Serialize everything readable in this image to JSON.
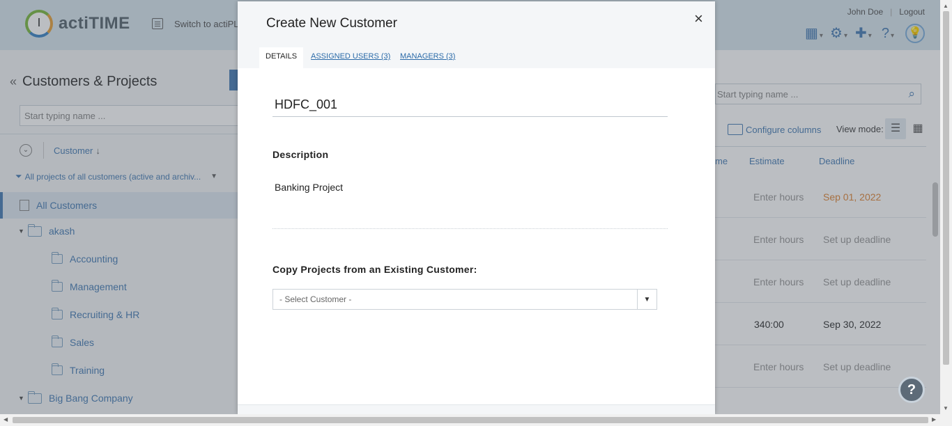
{
  "header": {
    "logo_text": "actiTIME",
    "switch_label": "Switch to actiPL",
    "user_name": "John Doe",
    "logout_label": "Logout"
  },
  "left_panel": {
    "title": "Customers & Projects",
    "search_placeholder": "Start typing name ...",
    "sort_label": "Customer",
    "filter_label": "All projects of all customers (active and archiv...",
    "all_customers_label": "All Customers",
    "tree": [
      {
        "label": "akash",
        "level": 0
      },
      {
        "label": "Accounting",
        "level": 1
      },
      {
        "label": "Management",
        "level": 1
      },
      {
        "label": "Recruiting & HR",
        "level": 1
      },
      {
        "label": "Sales",
        "level": 1
      },
      {
        "label": "Training",
        "level": 1
      },
      {
        "label": "Big Bang Company",
        "level": 0
      }
    ]
  },
  "right_panel": {
    "search_placeholder": "Start typing name ...",
    "configure_columns_label": "Configure columns",
    "view_mode_label": "View mode:",
    "columns": {
      "partial": "me",
      "estimate": "Estimate",
      "deadline": "Deadline"
    },
    "rows": [
      {
        "estimate": "Enter hours",
        "deadline": "Sep 01, 2022"
      },
      {
        "estimate": "Enter hours",
        "deadline": "Set up deadline"
      },
      {
        "estimate": "Enter hours",
        "deadline": "Set up deadline"
      },
      {
        "estimate": "340:00",
        "deadline": "Sep 30, 2022"
      },
      {
        "estimate": "Enter hours",
        "deadline": "Set up deadline"
      }
    ]
  },
  "modal": {
    "title": "Create New Customer",
    "close_symbol": "×",
    "tabs": [
      {
        "label": "DETAILS"
      },
      {
        "label": "ASSIGNED USERS (3)"
      },
      {
        "label": "MANAGERS (3)"
      }
    ],
    "name_value": "HDFC_001",
    "description_label": "Description",
    "description_value": "Banking Project",
    "copy_label": "Copy Projects from an Existing Customer:",
    "select_value": "- Select Customer -"
  },
  "help_fab_label": "?",
  "colors": {
    "accent": "#4a7fb5",
    "late_deadline": "#e0883a",
    "topbar": "#d9e6ef"
  }
}
